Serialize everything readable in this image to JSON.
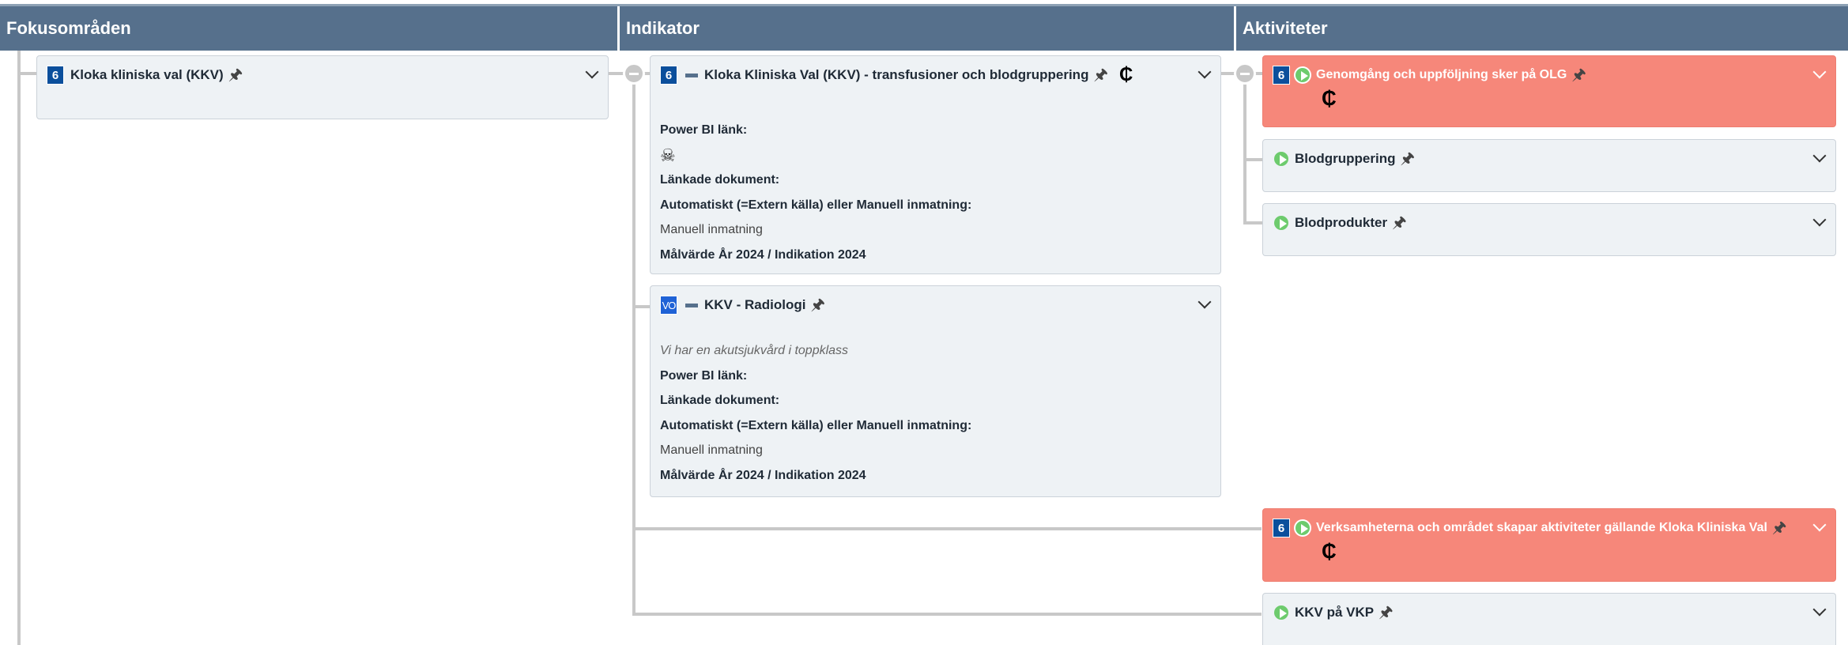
{
  "columns": {
    "focus": "Fokusområden",
    "indicator": "Indikator",
    "activities": "Aktiviteter"
  },
  "icons": {
    "pin": "pin-icon",
    "link": "link-icon",
    "powerbi": "powerbi-icon",
    "play": "play-icon",
    "chevron": "chevron-down-icon"
  },
  "colors": {
    "header": "#56708c",
    "badge": "#0b4f9c",
    "alert_card": "#f6877a",
    "play": "#6dcb6d"
  },
  "focus_cards": [
    {
      "badge": "6",
      "title": "Kloka kliniska val (KKV)"
    }
  ],
  "indicator_cards": [
    {
      "badge": "6",
      "title": "Kloka Kliniska Val (KKV) - transfusioner och blodgruppering",
      "rows": {
        "power_bi_label": "Power BI länk:",
        "power_bi_icon": "☠",
        "linked_docs_label": "Länkade dokument:",
        "source_label": "Automatiskt (=Extern källa) eller Manuell inmatning:",
        "source_value": "Manuell inmatning",
        "target_label": "Målvärde År 2024 / Indikation 2024"
      }
    },
    {
      "badge": "VO",
      "title": "KKV - Radiologi",
      "rows": {
        "description": "Vi har en akutsjukvård i toppklass",
        "power_bi_label": "Power BI länk:",
        "linked_docs_label": "Länkade dokument:",
        "source_label": "Automatiskt (=Extern källa) eller Manuell inmatning:",
        "source_value": "Manuell inmatning",
        "target_label": "Målvärde År 2024 / Indikation 2024"
      }
    }
  ],
  "activity_cards": [
    {
      "badge": "6",
      "title": "Genomgång och uppföljning sker på OLG",
      "status": "alert"
    },
    {
      "title": "Blodgruppering"
    },
    {
      "title": "Blodprodukter"
    },
    {
      "badge": "6",
      "title": "Verksamheterna och området skapar aktiviteter gällande Kloka Kliniska Val",
      "status": "alert"
    },
    {
      "title": "KKV på VKP"
    }
  ]
}
